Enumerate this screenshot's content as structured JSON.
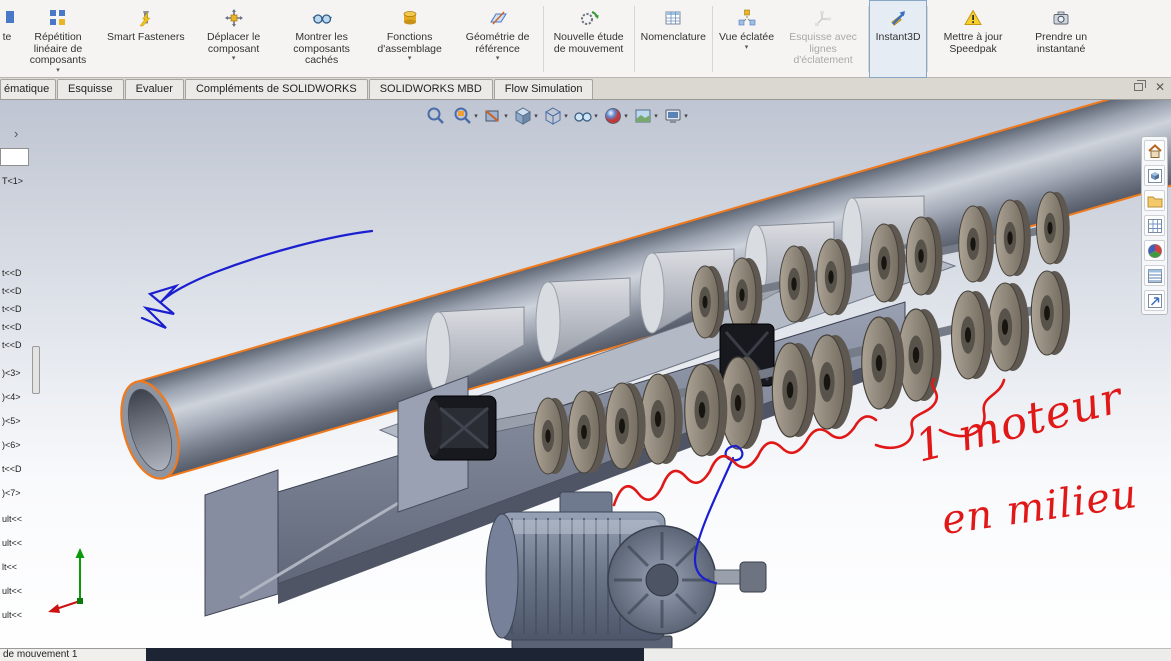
{
  "window": {
    "close_glyph": "✕"
  },
  "ribbon": {
    "buttons": [
      {
        "label": "te"
      },
      {
        "label": "Répétition linéaire de composants",
        "dropdown": "▾"
      },
      {
        "label": "Smart Fasteners"
      },
      {
        "label": "Déplacer le composant",
        "dropdown": "▾"
      },
      {
        "label": "Montrer les composants cachés"
      },
      {
        "label": "Fonctions d'assemblage",
        "dropdown": "▾"
      },
      {
        "label": "Géométrie de référence",
        "dropdown": "▾"
      },
      {
        "label": "Nouvelle étude de mouvement"
      },
      {
        "label": "Nomenclature"
      },
      {
        "label": "Vue éclatée",
        "dropdown": "▾"
      },
      {
        "label": "Esquisse avec lignes d'éclatement"
      },
      {
        "label": "Instant3D"
      },
      {
        "label": "Mettre à jour Speedpak"
      },
      {
        "label": "Prendre un instantané"
      }
    ]
  },
  "tabs": [
    "ématique",
    "Esquisse",
    "Evaluer",
    "Compléments de SOLIDWORKS",
    "SOLIDWORKS MBD",
    "Flow Simulation"
  ],
  "icons": {
    "dropdown": "▾"
  },
  "tree": {
    "expander": "›",
    "items": [
      "T<1>",
      "t<<D",
      "t<<D",
      "t<<D",
      "t<<D",
      "t<<D",
      ")<3>",
      ")<4>",
      ")<5>",
      ")<6>",
      "t<<D",
      ")<7>",
      "ult<<",
      "ult<<",
      "lt<<",
      "ult<<",
      "ult<<"
    ]
  },
  "annotation": {
    "line1": "1 moteur",
    "line2": "en milieu"
  },
  "motion_bar": {
    "tab": "de mouvement 1"
  }
}
